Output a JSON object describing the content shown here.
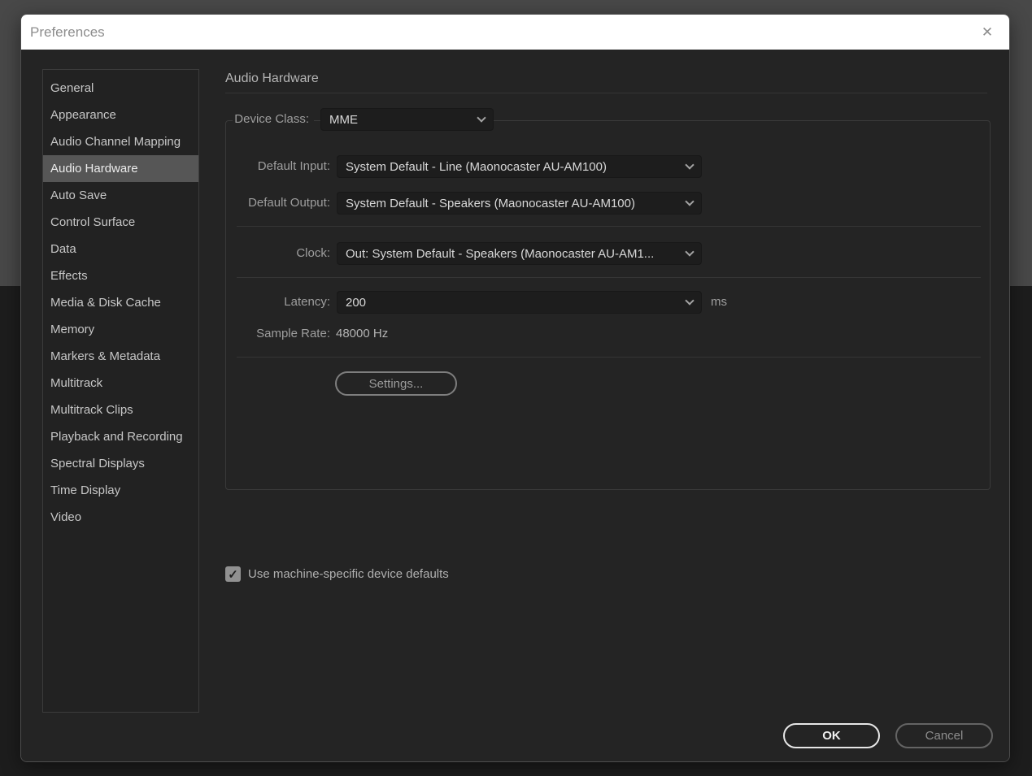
{
  "window": {
    "title": "Preferences"
  },
  "icons": {
    "close": "✕",
    "checkmark": "✓"
  },
  "sidebar": {
    "items": [
      {
        "label": "General",
        "selected": false
      },
      {
        "label": "Appearance",
        "selected": false
      },
      {
        "label": "Audio Channel Mapping",
        "selected": false
      },
      {
        "label": "Audio Hardware",
        "selected": true
      },
      {
        "label": "Auto Save",
        "selected": false
      },
      {
        "label": "Control Surface",
        "selected": false
      },
      {
        "label": "Data",
        "selected": false
      },
      {
        "label": "Effects",
        "selected": false
      },
      {
        "label": "Media & Disk Cache",
        "selected": false
      },
      {
        "label": "Memory",
        "selected": false
      },
      {
        "label": "Markers & Metadata",
        "selected": false
      },
      {
        "label": "Multitrack",
        "selected": false
      },
      {
        "label": "Multitrack Clips",
        "selected": false
      },
      {
        "label": "Playback and Recording",
        "selected": false
      },
      {
        "label": "Spectral Displays",
        "selected": false
      },
      {
        "label": "Time Display",
        "selected": false
      },
      {
        "label": "Video",
        "selected": false
      }
    ]
  },
  "panel": {
    "title": "Audio Hardware",
    "device_class": {
      "label": "Device Class:",
      "value": "MME"
    },
    "default_input": {
      "label": "Default Input:",
      "value": "System Default - Line (Maonocaster AU-AM100)"
    },
    "default_output": {
      "label": "Default Output:",
      "value": "System Default - Speakers (Maonocaster AU-AM100)"
    },
    "clock": {
      "label": "Clock:",
      "value": "Out: System Default - Speakers (Maonocaster AU-AM1..."
    },
    "latency": {
      "label": "Latency:",
      "value": "200",
      "unit": "ms"
    },
    "sample_rate": {
      "label": "Sample Rate:",
      "value": "48000 Hz"
    },
    "settings_button": "Settings...",
    "checkbox": {
      "label": "Use machine-specific device defaults",
      "checked": true
    }
  },
  "footer": {
    "ok": "OK",
    "cancel": "Cancel"
  },
  "colors": {
    "titlebar_bg": "#ffffff",
    "dialog_bg": "#242424",
    "sidebar_selected_bg": "#565656",
    "dropdown_bg": "#1d1d1d",
    "backdrop_top": "#484848",
    "backdrop_bottom": "#1d1d1d"
  }
}
